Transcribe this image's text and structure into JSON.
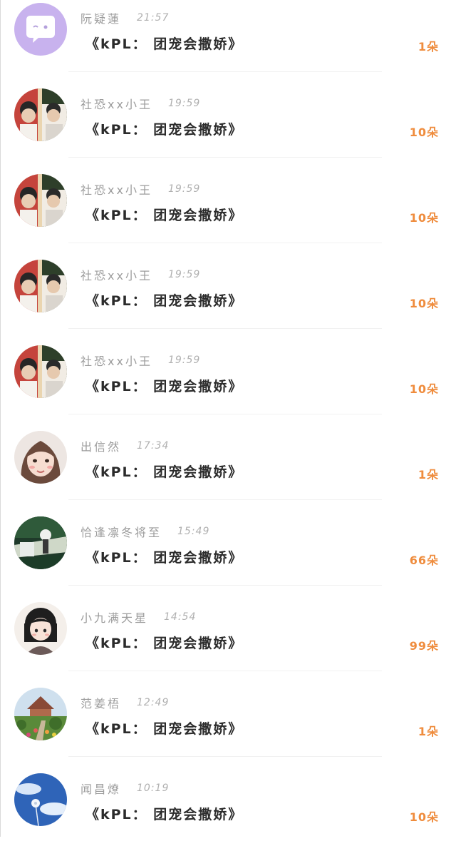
{
  "messages": [
    {
      "username": "阮疑蓮",
      "time": "21:57",
      "gift": "《kPL： 团宠会撒娇》",
      "count": "1朵",
      "avatar": "purple-bubble-icon"
    },
    {
      "username": "社恐xx小王",
      "time": "19:59",
      "gift": "《kPL： 团宠会撒娇》",
      "count": "10朵",
      "avatar": "duo-photo"
    },
    {
      "username": "社恐xx小王",
      "time": "19:59",
      "gift": "《kPL： 团宠会撒娇》",
      "count": "10朵",
      "avatar": "duo-photo"
    },
    {
      "username": "社恐xx小王",
      "time": "19:59",
      "gift": "《kPL： 团宠会撒娇》",
      "count": "10朵",
      "avatar": "duo-photo"
    },
    {
      "username": "社恐xx小王",
      "time": "19:59",
      "gift": "《kPL： 团宠会撒娇》",
      "count": "10朵",
      "avatar": "duo-photo"
    },
    {
      "username": "出信然",
      "time": "17:34",
      "gift": "《kPL： 团宠会撒娇》",
      "count": "1朵",
      "avatar": "girl-illustration"
    },
    {
      "username": "恰逢凛冬将至",
      "time": "15:49",
      "gift": "《kPL： 团宠会撒娇》",
      "count": "66朵",
      "avatar": "nature-scene"
    },
    {
      "username": "小九满天星",
      "time": "14:54",
      "gift": "《kPL： 团宠会撒娇》",
      "count": "99朵",
      "avatar": "cartoon-girl"
    },
    {
      "username": "范姜梧",
      "time": "12:49",
      "gift": "《kPL： 团宠会撒娇》",
      "count": "1朵",
      "avatar": "garden-house"
    },
    {
      "username": "闻昌燎",
      "time": "10:19",
      "gift": "《kPL： 团宠会撒娇》",
      "count": "10朵",
      "avatar": "sky-dandelion"
    }
  ],
  "colors": {
    "accent": "#ef8c3d",
    "username": "#9c9c9c",
    "text": "#2b2b2b",
    "avatar_purple": "#c8b2ee"
  }
}
